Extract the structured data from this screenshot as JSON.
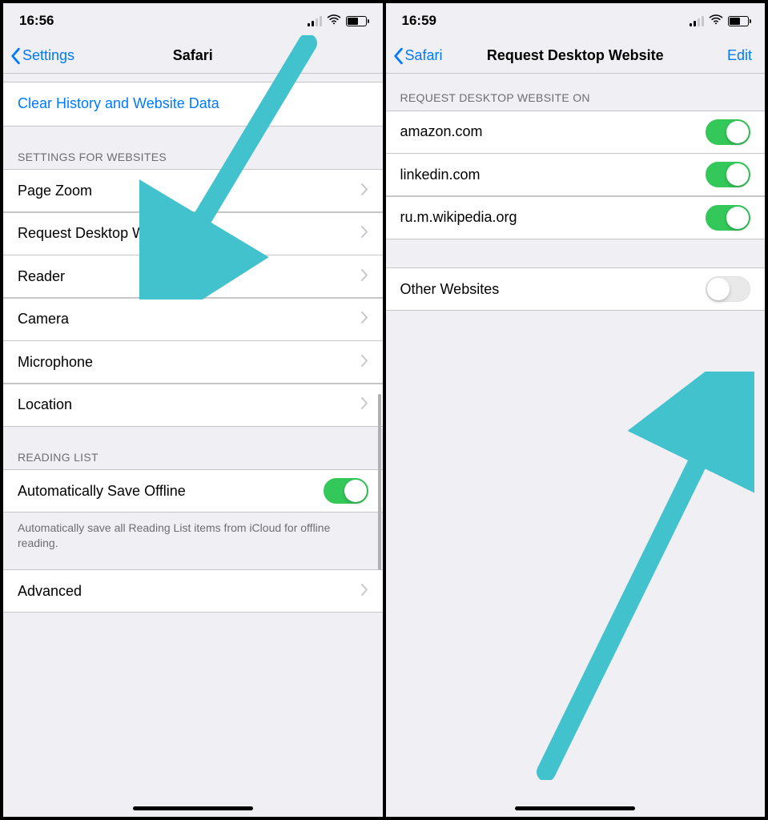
{
  "left": {
    "status": {
      "time": "16:56"
    },
    "nav": {
      "back": "Settings",
      "title": "Safari"
    },
    "clearHistory": "Clear History and Website Data",
    "settingsForWebsitesHeader": "SETTINGS FOR WEBSITES",
    "rows": {
      "pageZoom": "Page Zoom",
      "requestDesktop": "Request Desktop Website",
      "reader": "Reader",
      "camera": "Camera",
      "microphone": "Microphone",
      "location": "Location"
    },
    "readingListHeader": "READING LIST",
    "autosave": "Automatically Save Offline",
    "autosaveNote": "Automatically save all Reading List items from iCloud for offline reading.",
    "advanced": "Advanced"
  },
  "right": {
    "status": {
      "time": "16:59"
    },
    "nav": {
      "back": "Safari",
      "title": "Request Desktop Website",
      "edit": "Edit"
    },
    "sectionHeader": "REQUEST DESKTOP WEBSITE ON",
    "sites": {
      "amazon": "amazon.com",
      "linkedin": "linkedin.com",
      "wikipedia": "ru.m.wikipedia.org"
    },
    "other": "Other Websites"
  }
}
